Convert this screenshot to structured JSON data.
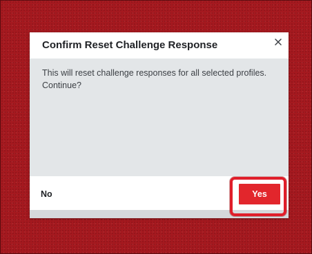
{
  "dialog": {
    "title": "Confirm Reset Challenge Response",
    "message_line1": "This will reset challenge responses for all selected profiles.",
    "message_line2": "Continue?",
    "no_label": "No",
    "yes_label": "Yes"
  },
  "icons": {
    "close": "close-icon"
  },
  "colors": {
    "backdrop": "#a5191f",
    "accent": "#e2262c",
    "highlight": "#e01e2a",
    "dialog_body": "#e3e6e8",
    "dialog_surface": "#ffffff"
  }
}
